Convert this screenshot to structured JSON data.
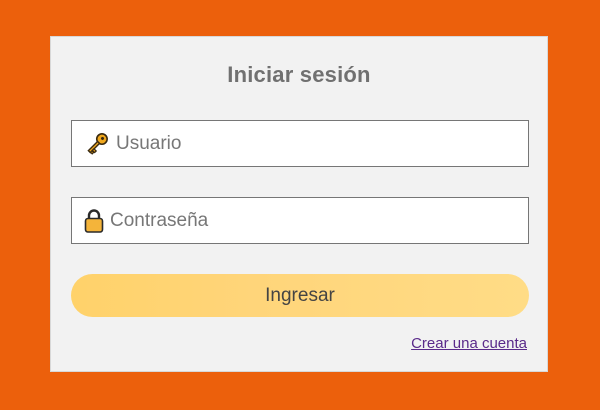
{
  "login": {
    "title": "Iniciar sesión",
    "username": {
      "placeholder": "Usuario",
      "value": "",
      "icon": "key-icon"
    },
    "password": {
      "placeholder": "Contraseña",
      "value": "",
      "icon": "lock-icon"
    },
    "submit_label": "Ingresar",
    "create_account_label": "Crear una cuenta"
  },
  "colors": {
    "page_background": "#ec600c",
    "card_background": "#f2f2f2",
    "button_background": "#ffd57a",
    "link_color": "#5a2a8a",
    "title_color": "#707070"
  }
}
